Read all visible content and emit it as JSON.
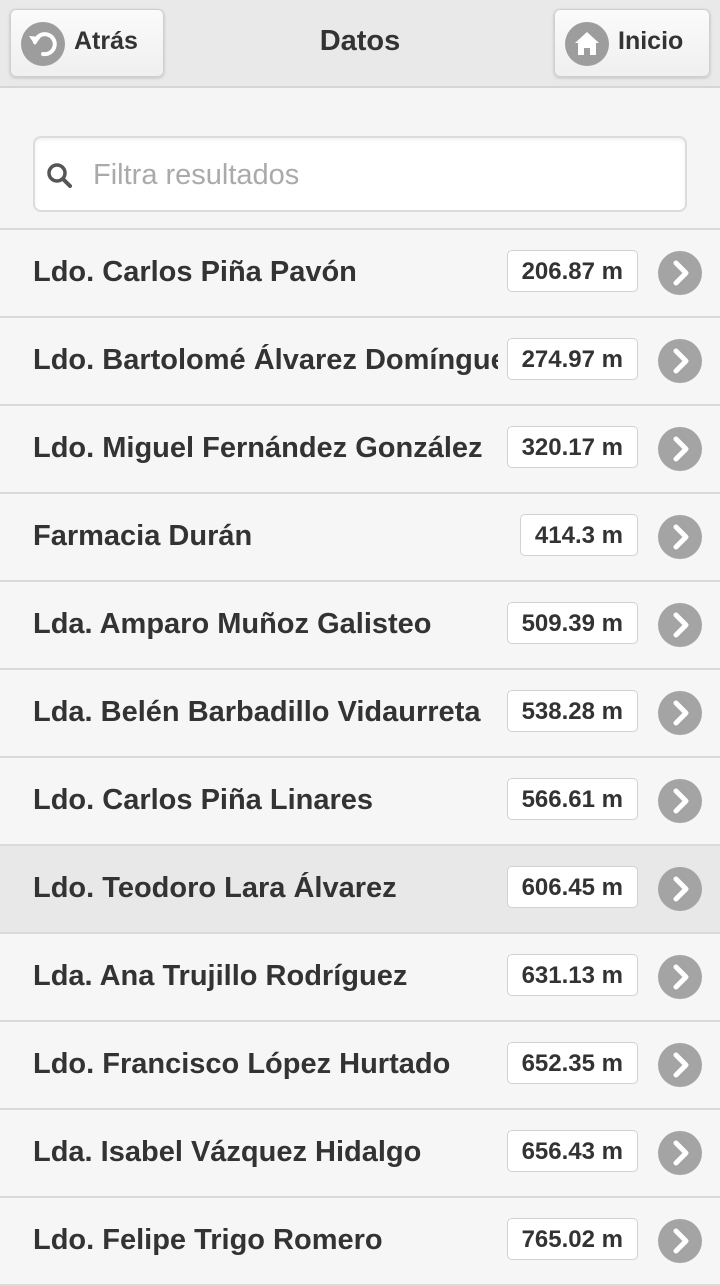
{
  "header": {
    "back_label": "Atrás",
    "title": "Datos",
    "home_label": "Inicio"
  },
  "search": {
    "placeholder": "Filtra resultados",
    "value": ""
  },
  "list": {
    "items": [
      {
        "name": "Ldo. Carlos Piña Pavón",
        "distance": "206.87 m"
      },
      {
        "name": "Ldo. Bartolomé Álvarez Domínguez",
        "distance": "274.97 m"
      },
      {
        "name": "Ldo. Miguel Fernández González",
        "distance": "320.17 m"
      },
      {
        "name": "Farmacia Durán",
        "distance": "414.3 m"
      },
      {
        "name": "Lda. Amparo Muñoz Galisteo",
        "distance": "509.39 m"
      },
      {
        "name": "Lda. Belén Barbadillo Vidaurreta",
        "distance": "538.28 m"
      },
      {
        "name": "Ldo. Carlos Piña Linares",
        "distance": "566.61 m"
      },
      {
        "name": "Ldo. Teodoro Lara Álvarez",
        "distance": "606.45 m"
      },
      {
        "name": "Lda. Ana Trujillo Rodríguez",
        "distance": "631.13 m"
      },
      {
        "name": "Ldo. Francisco López Hurtado",
        "distance": "652.35 m"
      },
      {
        "name": "Lda. Isabel Vázquez Hidalgo",
        "distance": "656.43 m"
      },
      {
        "name": "Ldo. Felipe Trigo Romero",
        "distance": "765.02 m"
      }
    ]
  },
  "colors": {
    "header_bg": "#e9e9e9",
    "icon_gray": "#a4a4a4",
    "highlight_row": "#e8e8e8"
  },
  "icons": {
    "back": "back-arrow-icon",
    "home": "home-icon",
    "search": "search-icon",
    "row_arrow": "chevron-right-icon"
  }
}
